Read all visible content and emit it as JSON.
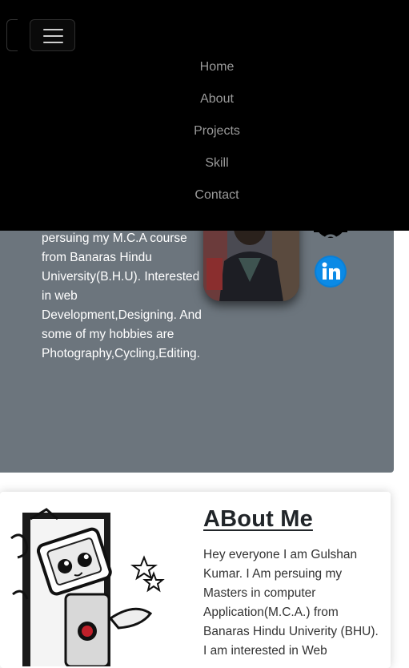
{
  "nav": {
    "items": [
      "Home",
      "About",
      "Projects",
      "Skill",
      "Contact"
    ]
  },
  "hero": {
    "bio": "persuing my M.C.A course from Banaras Hindu University(B.H.U). Interested in web Development,Designing. And some of my hobbies are Photography,Cycling,Editing."
  },
  "social": {
    "icons": [
      "github-icon",
      "linkedin-icon"
    ]
  },
  "about": {
    "title": "ABout Me",
    "text": "Hey everyone I am Gulshan Kumar. I Am persuing my Masters in computer Application(M.C.A.) from Banaras Hindu Univerity (BHU). I am interested in Web"
  },
  "colors": {
    "hero_bg": "#6c757d",
    "navbar_bg": "#000000",
    "nav_link": "#9a9a9a",
    "linkedin": "#0a7fd6"
  }
}
